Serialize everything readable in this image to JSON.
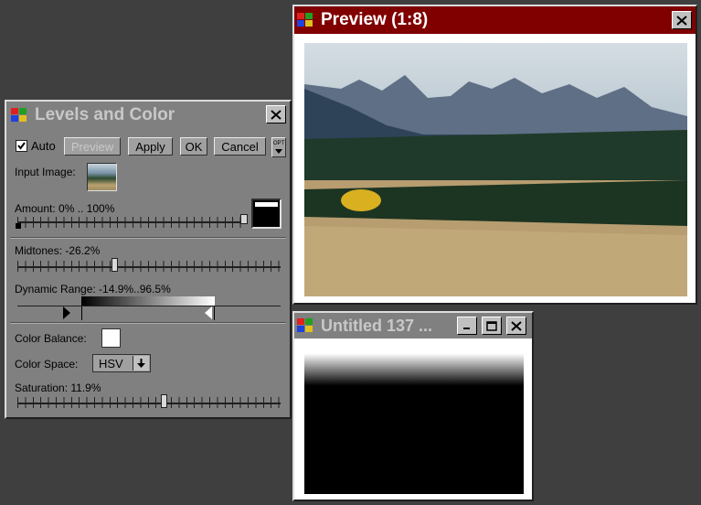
{
  "levels": {
    "title": "Levels and Color",
    "auto_label": "Auto",
    "auto_checked": true,
    "buttons": {
      "preview": "Preview",
      "apply": "Apply",
      "ok": "OK",
      "cancel": "Cancel",
      "opt": "OPT"
    },
    "input_image_label": "Input Image:",
    "amount_label": "Amount: 0% .. 100%",
    "midtones_label": "Midtones: -26.2%",
    "midtones_value": -26.2,
    "dynamic_range_label": "Dynamic Range: -14.9%..96.5%",
    "color_balance_label": "Color Balance:",
    "color_space_label": "Color Space:",
    "color_space_value": "HSV",
    "saturation_label": "Saturation: 11.9%",
    "saturation_value": 11.9
  },
  "preview": {
    "title": "Preview (1:8)"
  },
  "untitled": {
    "title": "Untitled 137 ..."
  },
  "colors": {
    "preview_title_bg": "#800000",
    "inactive_title_bg": "#808080",
    "desktop": "#3f3f3f"
  }
}
